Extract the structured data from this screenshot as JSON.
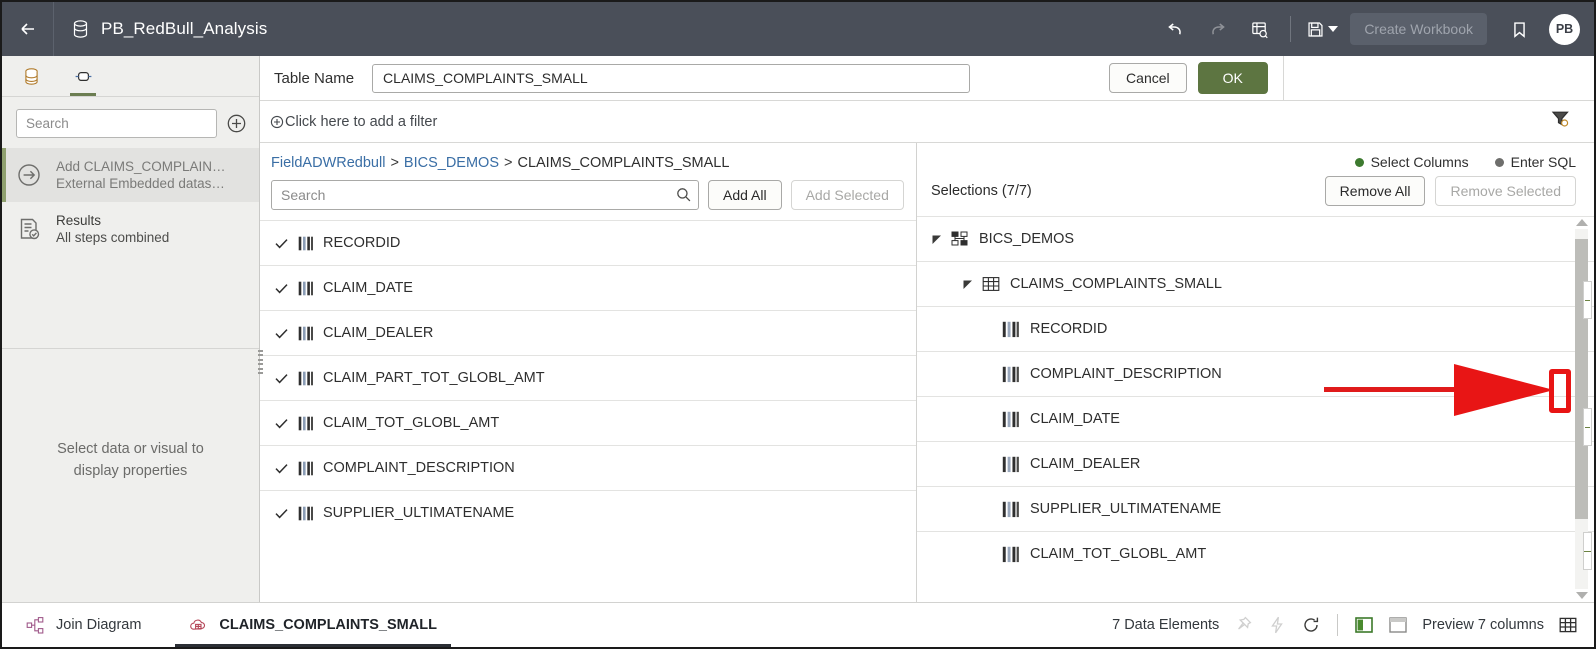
{
  "header": {
    "back_icon": "arrow-left-icon",
    "dataset_icon": "database-icon",
    "title": "PB_RedBull_Analysis",
    "undo_label": "Undo",
    "redo_label": "Redo",
    "inspect_label": "Inspect",
    "save_label": "Save",
    "create_workbook_label": "Create Workbook",
    "bookmark_label": "Bookmark",
    "avatar_initials": "PB",
    "bg_color": "#4a4f59"
  },
  "sidebar": {
    "tabs": [
      {
        "name": "data-tab",
        "icon": "database-icon",
        "active": false
      },
      {
        "name": "prepare-tab",
        "icon": "transform-icon",
        "active": true
      }
    ],
    "search_placeholder": "Search",
    "add_icon": "plus-circle-icon",
    "steps": [
      {
        "icon": "arrow-circle-icon",
        "title": "Add CLAIMS_COMPLAIN…",
        "subtitle": "External Embedded datas…",
        "selected": true
      },
      {
        "icon": "results-icon",
        "title": "Results",
        "subtitle": "All steps combined",
        "selected": false
      }
    ],
    "empty_message_line1": "Select data or visual to",
    "empty_message_line2": "display properties",
    "accent_color": "#8fa06f"
  },
  "table_name_row": {
    "label": "Table Name",
    "value": "CLAIMS_COMPLAINTS_SMALL",
    "cancel_label": "Cancel",
    "ok_label": "OK",
    "ok_color": "#5d7541"
  },
  "filter_row": {
    "add_filter_label": "Click here to add a filter",
    "add_icon": "plus-circle-icon",
    "filter_icon": "filter-icon"
  },
  "left_pane": {
    "breadcrumb": [
      {
        "text": "FieldADWRedbull",
        "link": true
      },
      {
        "text": "BICS_DEMOS",
        "link": true
      },
      {
        "text": "CLAIMS_COMPLAINTS_SMALL",
        "link": false
      }
    ],
    "breadcrumb_separator": ">",
    "search_placeholder": "Search",
    "search_icon": "magnifier-icon",
    "add_all_label": "Add All",
    "add_selected_label": "Add Selected",
    "add_selected_disabled": true,
    "columns": [
      {
        "name": "RECORDID",
        "checked": true
      },
      {
        "name": "CLAIM_DATE",
        "checked": true
      },
      {
        "name": "CLAIM_DEALER",
        "checked": true
      },
      {
        "name": "CLAIM_PART_TOT_GLOBL_AMT",
        "checked": true
      },
      {
        "name": "CLAIM_TOT_GLOBL_AMT",
        "checked": true
      },
      {
        "name": "COMPLAINT_DESCRIPTION",
        "checked": true
      },
      {
        "name": "SUPPLIER_ULTIMATENAME",
        "checked": true
      }
    ]
  },
  "right_pane": {
    "modes": [
      {
        "label": "Select Columns",
        "color": "#3d7a2f",
        "selected": true
      },
      {
        "label": "Enter SQL",
        "color": "#6e6e6c",
        "selected": false
      }
    ],
    "selections_title": "Selections (7/7)",
    "remove_all_label": "Remove All",
    "remove_selected_label": "Remove Selected",
    "remove_selected_disabled": true,
    "tree": [
      {
        "label": "BICS_DEMOS",
        "level": 0,
        "icon": "schema-icon",
        "expanded": true
      },
      {
        "label": "CLAIMS_COMPLAINTS_SMALL",
        "level": 1,
        "icon": "table-icon",
        "expanded": true
      },
      {
        "label": "RECORDID",
        "level": 2,
        "icon": "column-icon"
      },
      {
        "label": "COMPLAINT_DESCRIPTION",
        "level": 2,
        "icon": "column-icon"
      },
      {
        "label": "CLAIM_DATE",
        "level": 2,
        "icon": "column-icon"
      },
      {
        "label": "CLAIM_DEALER",
        "level": 2,
        "icon": "column-icon"
      },
      {
        "label": "SUPPLIER_ULTIMATENAME",
        "level": 2,
        "icon": "column-icon"
      },
      {
        "label": "CLAIM_TOT_GLOBL_AMT",
        "level": 2,
        "icon": "column-icon"
      }
    ]
  },
  "annotation": {
    "color": "#e81515",
    "shape": "arrow-pointing-right-to-highlighted-handle"
  },
  "bottom_bar": {
    "join_diagram_label": "Join Diagram",
    "join_diagram_icon": "join-diagram-icon",
    "table_tab_label": "CLAIMS_COMPLAINTS_SMALL",
    "table_tab_icon": "cloud-table-icon",
    "data_elements_label": "7 Data Elements",
    "pin_icon": "pin-icon",
    "lightning_icon": "lightning-icon",
    "refresh_icon": "refresh-icon",
    "layout_vertical_icon": "layout-vertical-icon",
    "layout_horizontal_icon": "layout-horizontal-icon",
    "preview_label": "Preview 7 columns",
    "grid_icon": "grid-icon"
  }
}
